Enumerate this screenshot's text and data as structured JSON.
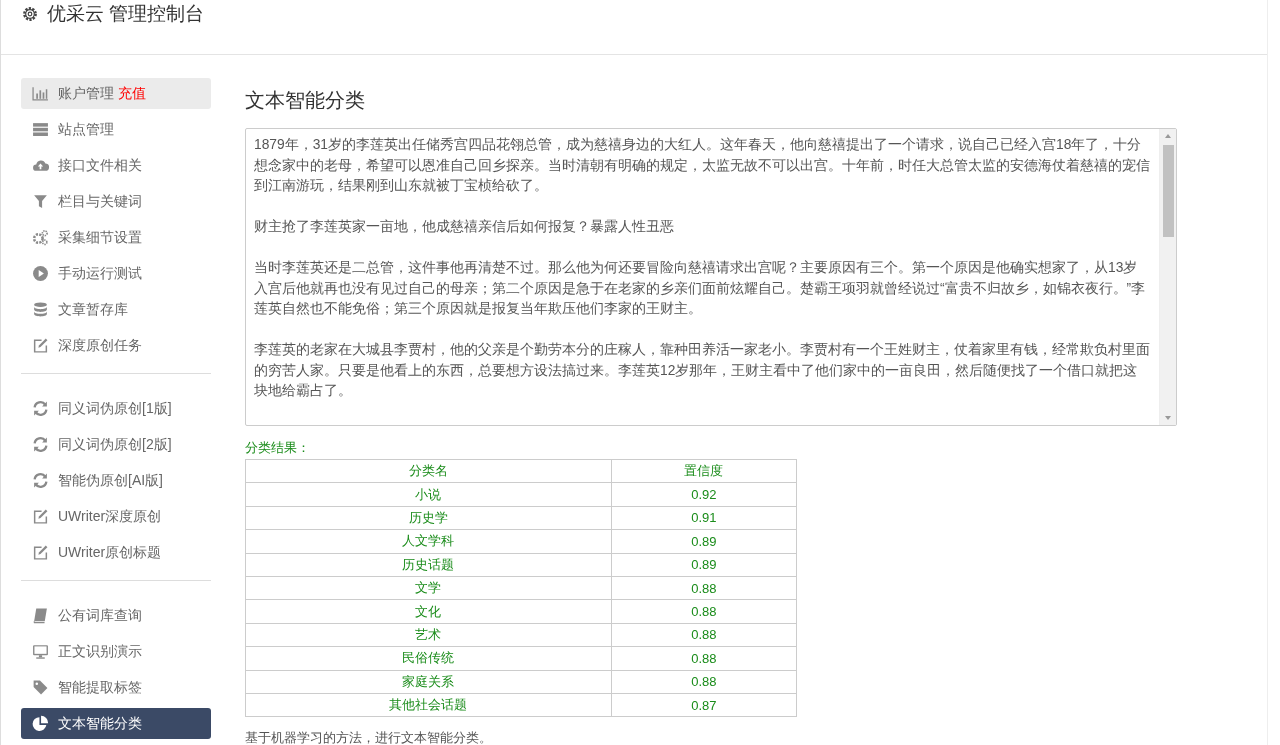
{
  "header": {
    "title": "优采云 管理控制台"
  },
  "sidebar": {
    "groups": [
      {
        "items": [
          {
            "label": "账户管理",
            "badge": "充值",
            "highlighted": true,
            "selected": false
          },
          {
            "label": "站点管理",
            "highlighted": false,
            "selected": false
          },
          {
            "label": "接口文件相关",
            "highlighted": false,
            "selected": false
          },
          {
            "label": "栏目与关键词",
            "highlighted": false,
            "selected": false
          },
          {
            "label": "采集细节设置",
            "highlighted": false,
            "selected": false
          },
          {
            "label": "手动运行测试",
            "highlighted": false,
            "selected": false
          },
          {
            "label": "文章暂存库",
            "highlighted": false,
            "selected": false
          },
          {
            "label": "深度原创任务",
            "highlighted": false,
            "selected": false
          }
        ]
      },
      {
        "items": [
          {
            "label": "同义词伪原创[1版]",
            "highlighted": false,
            "selected": false
          },
          {
            "label": "同义词伪原创[2版]",
            "highlighted": false,
            "selected": false
          },
          {
            "label": "智能伪原创[AI版]",
            "highlighted": false,
            "selected": false
          },
          {
            "label": "UWriter深度原创",
            "highlighted": false,
            "selected": false
          },
          {
            "label": "UWriter原创标题",
            "highlighted": false,
            "selected": false
          }
        ]
      },
      {
        "items": [
          {
            "label": "公有词库查询",
            "highlighted": false,
            "selected": false
          },
          {
            "label": "正文识别演示",
            "highlighted": false,
            "selected": false
          },
          {
            "label": "智能提取标签",
            "highlighted": false,
            "selected": false
          },
          {
            "label": "文本智能分类",
            "highlighted": false,
            "selected": true
          }
        ]
      }
    ]
  },
  "main": {
    "title": "文本智能分类",
    "article": [
      "1879年，31岁的李莲英出任储秀宫四品花翎总管，成为慈禧身边的大红人。这年春天，他向慈禧提出了一个请求，说自己已经入宫18年了，十分想念家中的老母，希望可以恩准自己回乡探亲。当时清朝有明确的规定，太监无故不可以出宫。十年前，时任大总管太监的安德海仗着慈禧的宠信到江南游玩，结果刚到山东就被丁宝桢给砍了。",
      "财主抢了李莲英家一亩地，他成慈禧亲信后如何报复？暴露人性丑恶",
      "当时李莲英还是二总管，这件事他再清楚不过。那么他为何还要冒险向慈禧请求出宫呢？主要原因有三个。第一个原因是他确实想家了，从13岁入宫后他就再也没有见过自己的母亲；第二个原因是急于在老家的乡亲们面前炫耀自己。楚霸王项羽就曾经说过“富贵不归故乡，如锦衣夜行。”李莲英自然也不能免俗；第三个原因就是报复当年欺压他们李家的王财主。",
      "李莲英的老家在大城县李贾村，他的父亲是个勤劳本分的庄稼人，靠种田养活一家老小。李贾村有一个王姓财主，仗着家里有钱，经常欺负村里面的穷苦人家。只要是他看上的东西，总要想方设法搞过来。李莲英12岁那年，王财主看中了他们家中的一亩良田，然后随便找了一个借口就把这块地给霸占了。"
    ],
    "result_label": "分类结果：",
    "table": {
      "columns": [
        "分类名",
        "置信度"
      ],
      "rows": [
        [
          "小说",
          "0.92"
        ],
        [
          "历史学",
          "0.91"
        ],
        [
          "人文学科",
          "0.89"
        ],
        [
          "历史话题",
          "0.89"
        ],
        [
          "文学",
          "0.88"
        ],
        [
          "文化",
          "0.88"
        ],
        [
          "艺术",
          "0.88"
        ],
        [
          "民俗传统",
          "0.88"
        ],
        [
          "家庭关系",
          "0.88"
        ],
        [
          "其他社会话题",
          "0.87"
        ]
      ]
    },
    "description": "基于机器学习的方法，进行文本智能分类。"
  }
}
